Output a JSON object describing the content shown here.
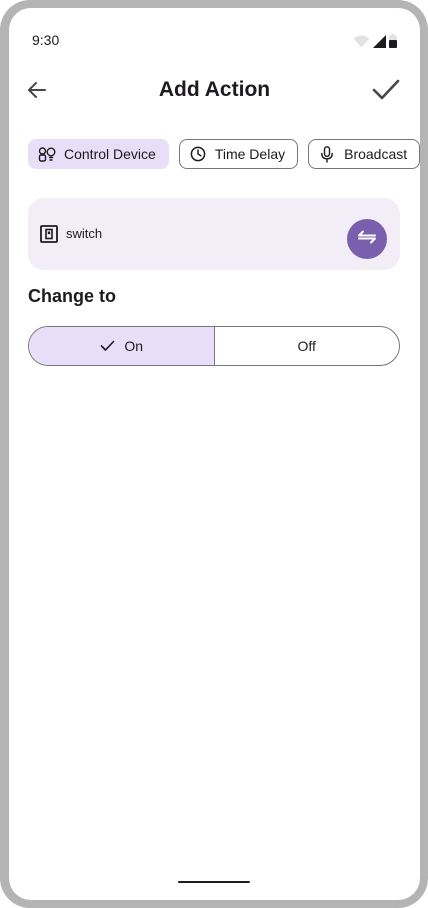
{
  "status_bar": {
    "time": "9:30",
    "icons": [
      "wifi-icon",
      "signal-icon",
      "battery-icon"
    ]
  },
  "top_bar": {
    "title": "Add Action",
    "back_icon": "arrow-back-icon",
    "confirm_icon": "check-icon"
  },
  "chips": [
    {
      "label": "Control Device",
      "icon": "devices-icon",
      "selected": true
    },
    {
      "label": "Time Delay",
      "icon": "clock-icon",
      "selected": false
    },
    {
      "label": "Broadcast",
      "icon": "mic-icon",
      "selected": false
    }
  ],
  "device_card": {
    "icon": "switch-icon",
    "name": "switch",
    "action_icon": "swap-arrows-icon"
  },
  "change_to": {
    "title": "Change to",
    "options": [
      {
        "label": "On",
        "selected": true
      },
      {
        "label": "Off",
        "selected": false
      }
    ]
  },
  "colors": {
    "accent": "#7a5fae",
    "chip_selected": "#e8def8",
    "card_bg": "#f3edf7",
    "outline": "#79747e",
    "text": "#1d1b20"
  }
}
